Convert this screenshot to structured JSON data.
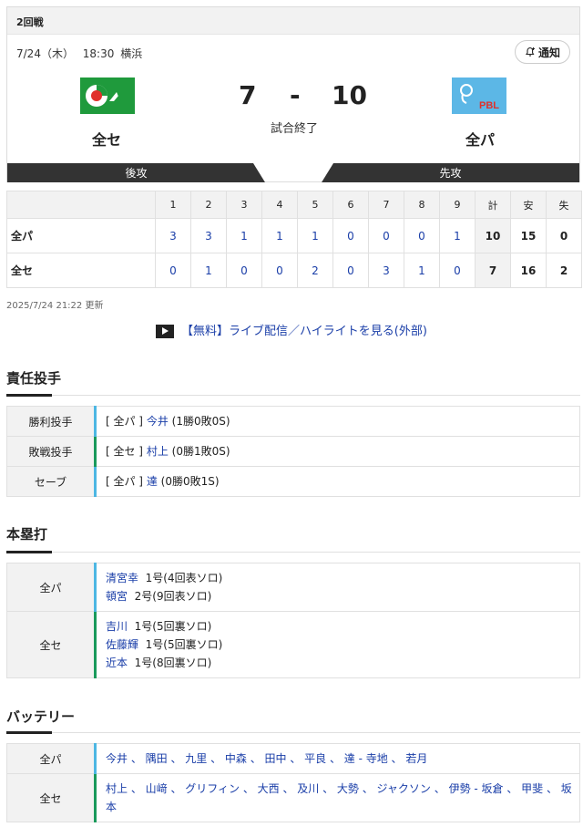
{
  "game": {
    "round": "2回戦",
    "date": "7/24（木）",
    "time": "18:30",
    "venue": "横浜",
    "notify_label": "通知",
    "home": {
      "name": "全セ",
      "score": "7",
      "logo": "central-league-logo",
      "color": "#1f9a3c",
      "side": "後攻"
    },
    "away": {
      "name": "全パ",
      "score": "10",
      "logo": "pacific-league-logo",
      "logo_text": "PBL",
      "color": "#5cb7e6",
      "side": "先攻"
    },
    "separator": "-",
    "status": "試合終了"
  },
  "linescore": {
    "headers": [
      "1",
      "2",
      "3",
      "4",
      "5",
      "6",
      "7",
      "8",
      "9",
      "計",
      "安",
      "失"
    ],
    "rows": [
      {
        "team": "全パ",
        "innings": [
          "3",
          "3",
          "1",
          "1",
          "1",
          "0",
          "0",
          "0",
          "1"
        ],
        "R": "10",
        "H": "15",
        "E": "0"
      },
      {
        "team": "全セ",
        "innings": [
          "0",
          "1",
          "0",
          "0",
          "2",
          "0",
          "3",
          "1",
          "0"
        ],
        "R": "7",
        "H": "16",
        "E": "2"
      }
    ]
  },
  "updated": "2025/7/24 21:22 更新",
  "live_link": "【無料】ライブ配信／ハイライトを見る(外部)",
  "pitchers": {
    "title": "責任投手",
    "rows": [
      {
        "label": "勝利投手",
        "team": "[ 全パ ]",
        "name": "今井",
        "record": "(1勝0敗0S)"
      },
      {
        "label": "敗戦投手",
        "team": "[ 全セ ]",
        "name": "村上",
        "record": "(0勝1敗0S)"
      },
      {
        "label": "セーブ",
        "team": "[ 全パ ]",
        "name": "達",
        "record": "(0勝0敗1S)"
      }
    ]
  },
  "homeruns": {
    "title": "本塁打",
    "teams": [
      {
        "team": "全パ",
        "entries": [
          {
            "name": "清宮幸",
            "detail": "1号(4回表ソロ)"
          },
          {
            "name": "頓宮",
            "detail": "2号(9回表ソロ)"
          }
        ]
      },
      {
        "team": "全セ",
        "entries": [
          {
            "name": "吉川",
            "detail": "1号(5回裏ソロ)"
          },
          {
            "name": "佐藤輝",
            "detail": "1号(5回裏ソロ)"
          },
          {
            "name": "近本",
            "detail": "1号(8回裏ソロ)"
          }
        ]
      }
    ]
  },
  "battery": {
    "title": "バッテリー",
    "teams": [
      {
        "team": "全パ",
        "text": "今井 、 隅田 、 九里 、 中森 、 田中 、 平良 、 達 - 寺地 、 若月"
      },
      {
        "team": "全セ",
        "text": "村上 、 山﨑 、 グリフィン 、 大西 、 及川 、 大勢 、 ジャクソン 、 伊勢 - 坂倉 、 甲斐 、 坂本"
      }
    ]
  }
}
